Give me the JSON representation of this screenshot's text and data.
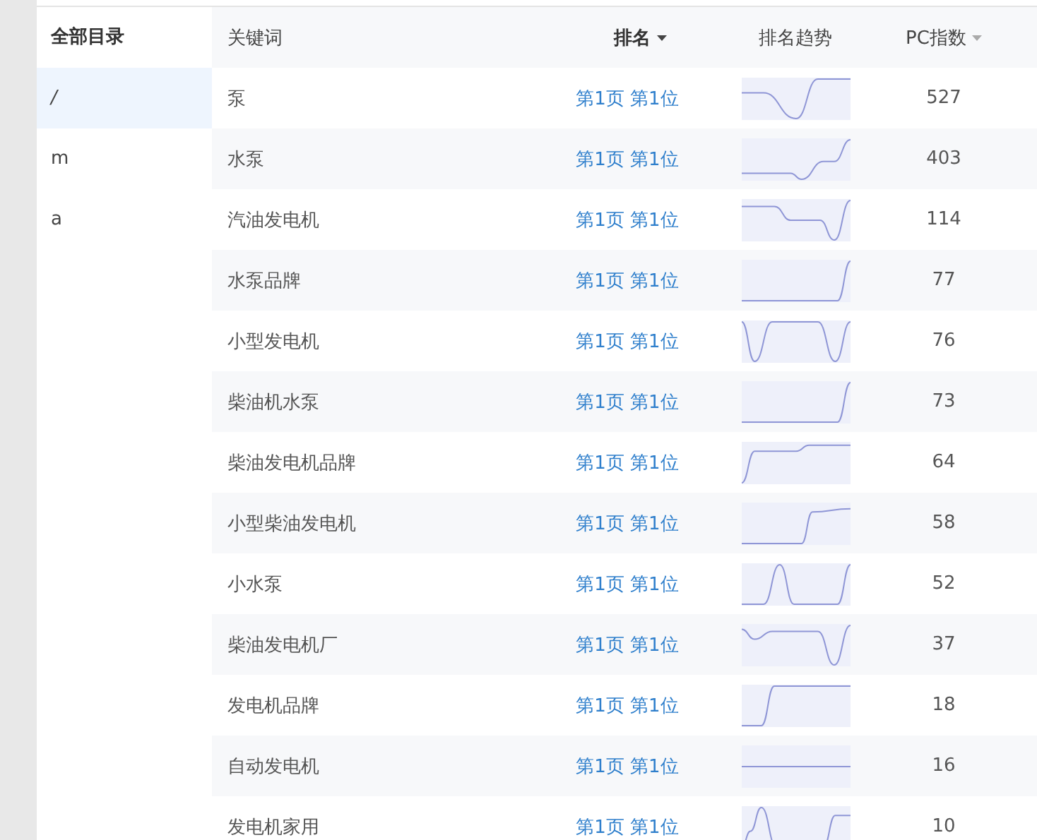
{
  "sidebar": {
    "title": "全部目录",
    "items": [
      {
        "label": "/",
        "selected": true
      },
      {
        "label": "m",
        "selected": false
      },
      {
        "label": "a",
        "selected": false
      }
    ]
  },
  "table": {
    "columns": [
      {
        "label": "关键词",
        "sortable": false,
        "sorted": false
      },
      {
        "label": "排名",
        "sortable": true,
        "sorted": true
      },
      {
        "label": "排名趋势",
        "sortable": false,
        "sorted": false
      },
      {
        "label": "PC指数",
        "sortable": true,
        "sorted": false
      }
    ],
    "rows": [
      {
        "keyword": "泵",
        "rank": "第1页 第1位",
        "pc_index": "527"
      },
      {
        "keyword": "水泵",
        "rank": "第1页 第1位",
        "pc_index": "403"
      },
      {
        "keyword": "汽油发电机",
        "rank": "第1页 第1位",
        "pc_index": "114"
      },
      {
        "keyword": "水泵品牌",
        "rank": "第1页 第1位",
        "pc_index": "77"
      },
      {
        "keyword": "小型发电机",
        "rank": "第1页 第1位",
        "pc_index": "76"
      },
      {
        "keyword": "柴油机水泵",
        "rank": "第1页 第1位",
        "pc_index": "73"
      },
      {
        "keyword": "柴油发电机品牌",
        "rank": "第1页 第1位",
        "pc_index": "64"
      },
      {
        "keyword": "小型柴油发电机",
        "rank": "第1页 第1位",
        "pc_index": "58"
      },
      {
        "keyword": "小水泵",
        "rank": "第1页 第1位",
        "pc_index": "52"
      },
      {
        "keyword": "柴油发电机厂",
        "rank": "第1页 第1位",
        "pc_index": "37"
      },
      {
        "keyword": "发电机品牌",
        "rank": "第1页 第1位",
        "pc_index": "18"
      },
      {
        "keyword": "自动发电机",
        "rank": "第1页 第1位",
        "pc_index": "16"
      },
      {
        "keyword": "发电机家用",
        "rank": "第1页 第1位",
        "pc_index": "10"
      }
    ]
  }
}
